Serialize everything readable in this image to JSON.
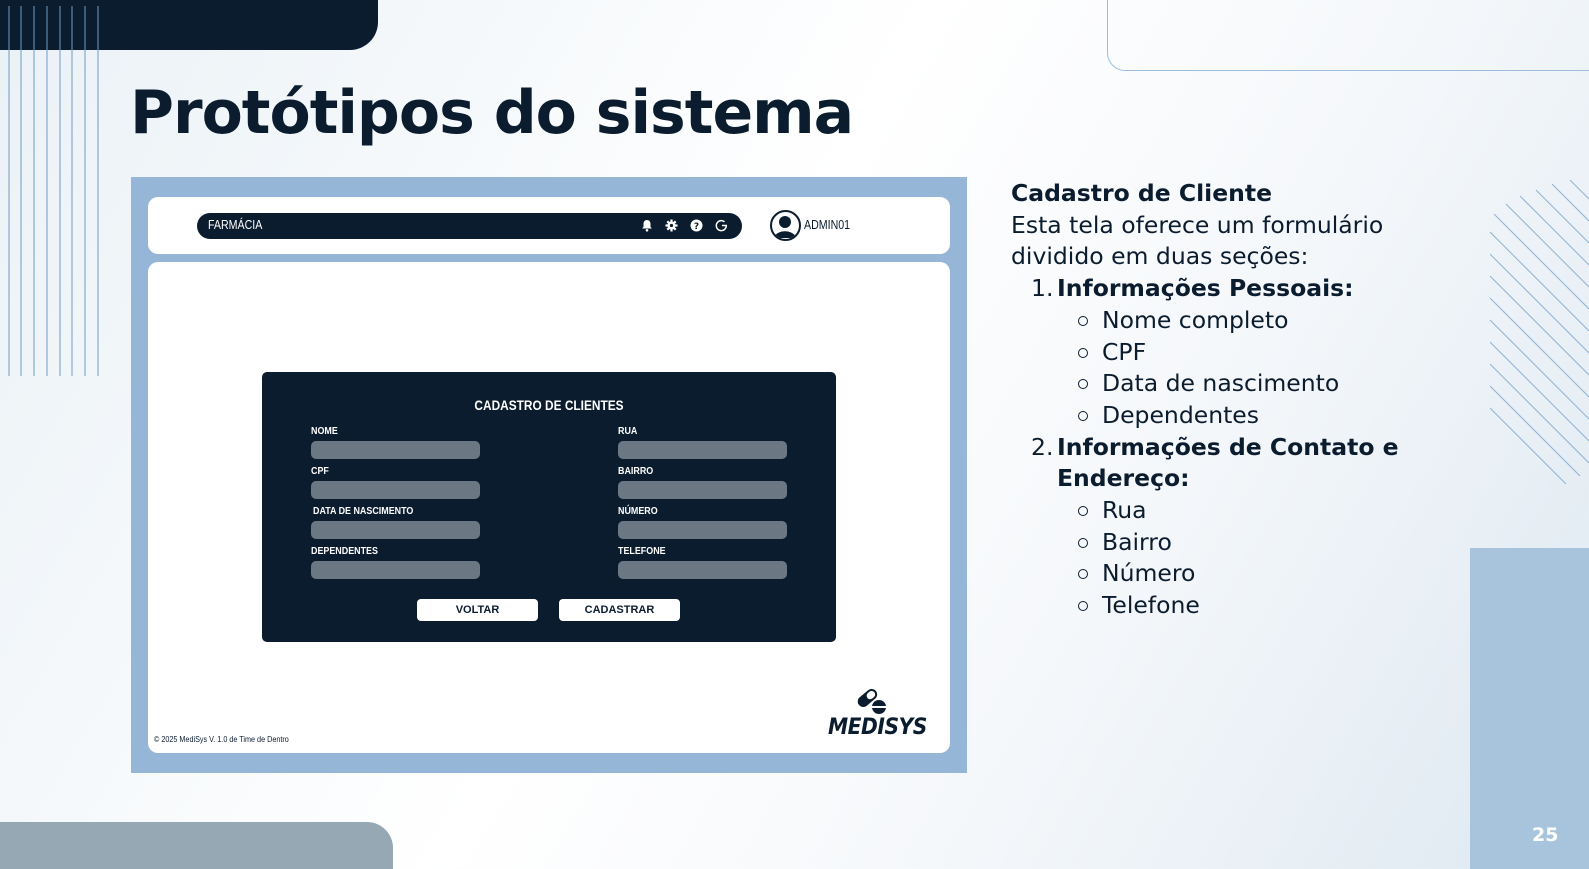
{
  "slide": {
    "title": "Protótipos do sistema",
    "page_number": "25"
  },
  "mock": {
    "navbar": {
      "title": "FARMÁCIA",
      "icons": [
        "bell-icon",
        "gear-icon",
        "help-icon",
        "logout-icon"
      ]
    },
    "user": {
      "label": "ADMIN01"
    },
    "form": {
      "title": "CADASTRO DE CLIENTES",
      "left_fields": [
        {
          "label": "NOME",
          "value": ""
        },
        {
          "label": "CPF",
          "value": ""
        },
        {
          "label": "DATA DE NASCIMENTO",
          "value": ""
        },
        {
          "label": "DEPENDENTES",
          "value": ""
        }
      ],
      "right_fields": [
        {
          "label": "RUA",
          "value": ""
        },
        {
          "label": "BAIRRO",
          "value": ""
        },
        {
          "label": "NÚMERO",
          "value": ""
        },
        {
          "label": "TELEFONE",
          "value": ""
        }
      ],
      "back_button": "VOLTAR",
      "submit_button": "CADASTRAR"
    },
    "footer": "© 2025 MediSys V. 1.0 de Time de Dentro",
    "logo_text": "MEDISYS"
  },
  "description": {
    "heading": "Cadastro de Cliente",
    "intro": "Esta tela oferece um formulário dividido em duas seções:",
    "sections": [
      {
        "number": "1.",
        "title": "Informações Pessoais",
        "suffix": ":",
        "items": [
          "Nome completo",
          "CPF",
          "Data de nascimento",
          "Dependentes"
        ]
      },
      {
        "number": "2.",
        "title": "Informações de Contato e Endereço",
        "suffix": ":",
        "items": [
          "Rua",
          "Bairro",
          "Número",
          "Telefone"
        ]
      }
    ]
  },
  "colors": {
    "navy": "#0b1c2e",
    "frame_blue": "#96b6d7",
    "input_gray": "#6c7784",
    "panel_blue": "#a8c4dc"
  }
}
